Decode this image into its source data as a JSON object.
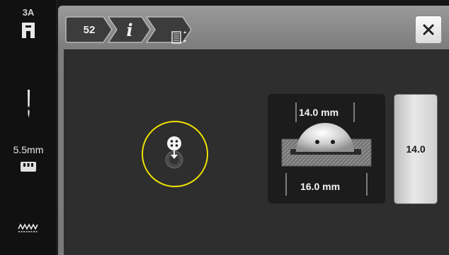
{
  "sidebar": {
    "stitch_code": "3A",
    "presser_foot_icon": "presser-foot-icon",
    "needle_icon": "needle-icon",
    "stitch_width": "5.5mm",
    "feed_dog_icon": "feed-dog-icon",
    "stitch_pattern_icon": "zigzag-stitch-icon"
  },
  "header": {
    "breadcrumb": [
      {
        "label": "52"
      },
      {
        "label": "i"
      },
      {
        "icon": "buttonhole-settings-icon"
      }
    ],
    "close_icon": "close-icon"
  },
  "main": {
    "sensor_icon": "button-sensor-icon",
    "button_measure": {
      "button_diameter": "14.0 mm",
      "buttonhole_length": "16.0 mm"
    },
    "value_button_label": "14.0"
  },
  "colors": {
    "sensor_ring": "#f0e300",
    "panel_bg": "#2e2e2e",
    "frame": "#8a8a8a"
  }
}
